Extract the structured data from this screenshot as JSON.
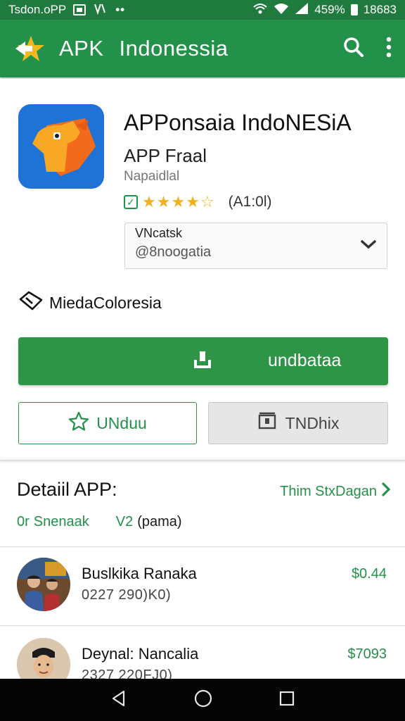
{
  "status_bar": {
    "carrier": "Tsdon.oPP",
    "battery": "459%",
    "time": "18683"
  },
  "app_bar": {
    "title_part1": "APK",
    "title_part2": "Indonessia"
  },
  "app": {
    "name": "APPonsaia IndoNESiA",
    "subtitle": "APP Fraal",
    "developer": "Napaidlal",
    "rating_count": "(A1:0l)",
    "version_label": "VNcatsk",
    "version_value": "@8noogatia",
    "category": "MiedaColoresia"
  },
  "buttons": {
    "download": "undbataa",
    "unduh": "UNduu",
    "tindak": "TNDhix"
  },
  "details": {
    "title": "Detaiil APP:",
    "link": "Thim StxDagan",
    "meta1": "Snenaak",
    "meta1_icon": "0r",
    "meta2": "(pama)",
    "meta2_icon": "V2"
  },
  "list": [
    {
      "name": "Buslkika Ranaka",
      "sub": "0227 290)K0)",
      "price": "$0.44"
    },
    {
      "name": "Deynal: Nancalia",
      "sub": "2327 220FJ0)",
      "price": "$7093"
    }
  ],
  "colors": {
    "primary": "#23914a",
    "status": "#1f7a3e",
    "star": "#f0b120"
  }
}
